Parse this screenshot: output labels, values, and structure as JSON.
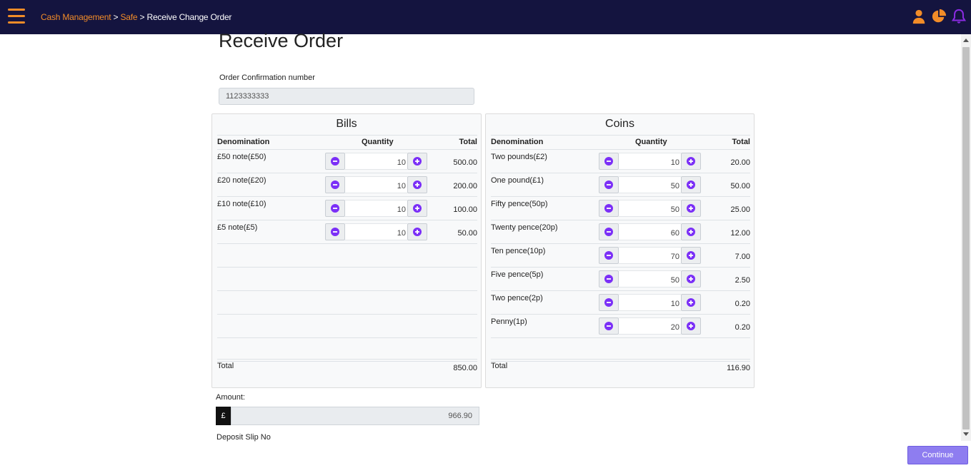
{
  "header": {
    "breadcrumb": [
      "Cash Management",
      "Safe",
      "Receive Change Order"
    ],
    "separator": ">"
  },
  "page": {
    "title": "Receive Order",
    "confirmation_label": "Order Confirmation number",
    "confirmation_value": "1123333333"
  },
  "columns": {
    "denomination": "Denomination",
    "quantity": "Quantity",
    "total": "Total"
  },
  "bills": {
    "title": "Bills",
    "rows": [
      {
        "denomination": "£50 note(£50)",
        "quantity": "10",
        "total": "500.00"
      },
      {
        "denomination": "£20 note(£20)",
        "quantity": "10",
        "total": "200.00"
      },
      {
        "denomination": "£10 note(£10)",
        "quantity": "10",
        "total": "100.00"
      },
      {
        "denomination": "£5 note(£5)",
        "quantity": "10",
        "total": "50.00"
      }
    ],
    "total_label": "Total",
    "total_value": "850.00"
  },
  "coins": {
    "title": "Coins",
    "rows": [
      {
        "denomination": "Two pounds(£2)",
        "quantity": "10",
        "total": "20.00"
      },
      {
        "denomination": "One pound(£1)",
        "quantity": "50",
        "total": "50.00"
      },
      {
        "denomination": "Fifty pence(50p)",
        "quantity": "50",
        "total": "25.00"
      },
      {
        "denomination": "Twenty pence(20p)",
        "quantity": "60",
        "total": "12.00"
      },
      {
        "denomination": "Ten pence(10p)",
        "quantity": "70",
        "total": "7.00"
      },
      {
        "denomination": "Five pence(5p)",
        "quantity": "50",
        "total": "2.50"
      },
      {
        "denomination": "Two pence(2p)",
        "quantity": "10",
        "total": "0.20"
      },
      {
        "denomination": "Penny(1p)",
        "quantity": "20",
        "total": "0.20"
      }
    ],
    "total_label": "Total",
    "total_value": "116.90"
  },
  "amount": {
    "label": "Amount:",
    "currency": "£",
    "value": "966.90"
  },
  "deposit_slip_label": "Deposit Slip No",
  "continue_label": "Continue",
  "colors": {
    "header_bg": "#14143f",
    "accent_orange": "#f28c28",
    "accent_purple": "#7b2ff7",
    "continue_bg": "#8e7df0"
  },
  "icons": [
    "hamburger-menu-icon",
    "user-icon",
    "pie-chart-icon",
    "bell-icon",
    "minus-circle-icon",
    "plus-circle-icon"
  ]
}
